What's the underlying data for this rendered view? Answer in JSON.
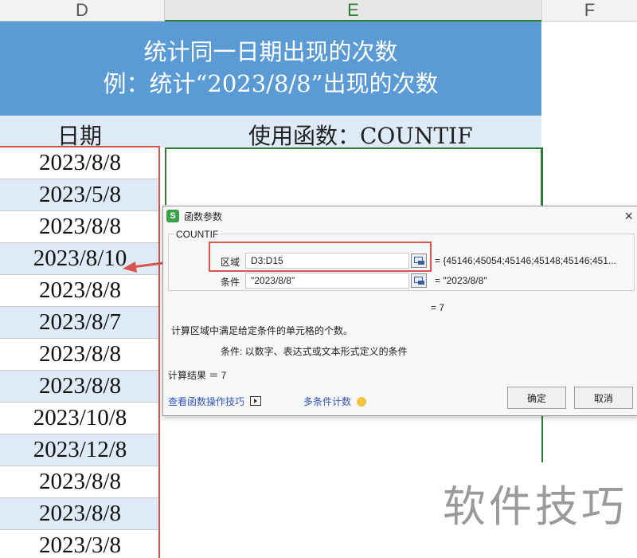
{
  "columns": {
    "d": "D",
    "e": "E",
    "f": "F"
  },
  "banner": {
    "line1": "统计同一日期出现的次数",
    "line2": "例：统计“2023/8/8”出现的次数"
  },
  "header": {
    "date_label": "日期",
    "func_label": "使用函数：COUNTIF"
  },
  "dates": [
    "2023/8/8",
    "2023/5/8",
    "2023/8/8",
    "2023/8/10",
    "2023/8/8",
    "2023/8/7",
    "2023/8/8",
    "2023/8/8",
    "2023/10/8",
    "2023/12/8",
    "2023/8/8",
    "2023/8/8",
    "2023/3/8"
  ],
  "dialog": {
    "title": "函数参数",
    "app_icon": "S",
    "close": "×",
    "function_name": "COUNTIF",
    "range_label": "区域",
    "range_value": "D3:D15",
    "range_result": "= {45146;45054;45146;45148;45146;451...",
    "criteria_label": "条件",
    "criteria_value": "\"2023/8/8\"",
    "criteria_result": "= \"2023/8/8\"",
    "formula_result": "= 7",
    "description": "计算区域中满足给定条件的单元格的个数。",
    "criteria_help": "条件:  以数字、表达式或文本形式定义的条件",
    "calc_result": "计算结果 ＝ 7",
    "tips_link": "查看函数操作技巧",
    "multi_link": "多条件计数",
    "ok": "确定",
    "cancel": "取消"
  },
  "watermark": "软件技巧",
  "colors": {
    "banner": "#5b9bd5",
    "alt_row": "#deebf7",
    "highlight": "#d9534f",
    "active_col": "#2e7d32"
  }
}
